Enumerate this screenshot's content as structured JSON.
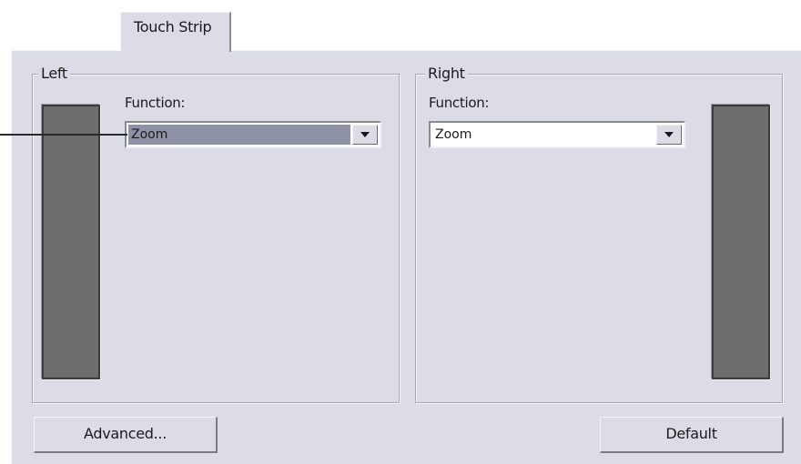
{
  "tabs": [
    {
      "label": "Touch Strip",
      "active": true
    }
  ],
  "left_group": {
    "title": "Left",
    "function_label": "Function:",
    "function_value": "Zoom",
    "selected": true
  },
  "right_group": {
    "title": "Right",
    "function_label": "Function:",
    "function_value": "Zoom",
    "selected": false
  },
  "buttons": {
    "advanced": "Advanced...",
    "default": "Default"
  },
  "colors": {
    "panel_bg": "#dcdce6",
    "strip": "#6d6d6d",
    "selection": "#8e92a6"
  },
  "icons": {
    "dropdown_arrow": "chevron-down-icon"
  }
}
